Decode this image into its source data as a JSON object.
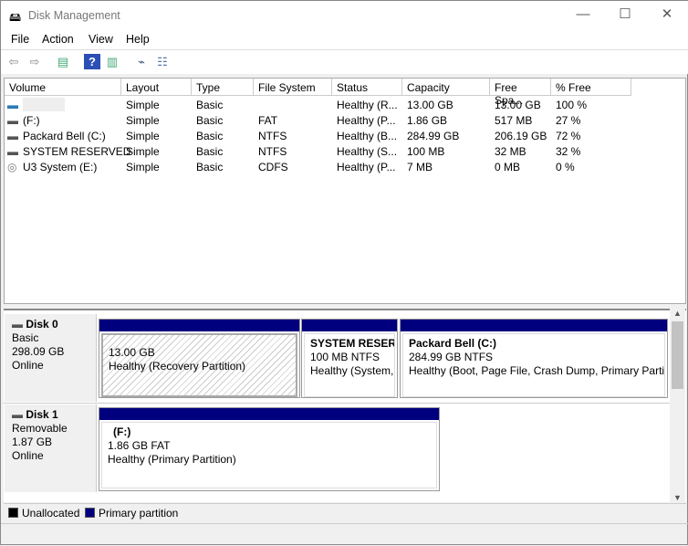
{
  "window": {
    "title": "Disk Management",
    "minimize": "—",
    "maximize": "☐",
    "close": "✕"
  },
  "menu": [
    "File",
    "Action",
    "View",
    "Help"
  ],
  "columns": [
    "Volume",
    "Layout",
    "Type",
    "File System",
    "Status",
    "Capacity",
    "Free Spa...",
    "% Free"
  ],
  "volumes": [
    {
      "volume": "",
      "layout": "Simple",
      "type": "Basic",
      "fs": "",
      "status": "Healthy (R...",
      "capacity": "13.00 GB",
      "free": "13.00 GB",
      "pct": "100 %"
    },
    {
      "volume": " (F:)",
      "layout": "Simple",
      "type": "Basic",
      "fs": "FAT",
      "status": "Healthy (P...",
      "capacity": "1.86 GB",
      "free": "517 MB",
      "pct": "27 %"
    },
    {
      "volume": "Packard Bell (C:)",
      "layout": "Simple",
      "type": "Basic",
      "fs": "NTFS",
      "status": "Healthy (B...",
      "capacity": "284.99 GB",
      "free": "206.19 GB",
      "pct": "72 %"
    },
    {
      "volume": "SYSTEM RESERVED",
      "layout": "Simple",
      "type": "Basic",
      "fs": "NTFS",
      "status": "Healthy (S...",
      "capacity": "100 MB",
      "free": "32 MB",
      "pct": "32 %"
    },
    {
      "volume": "U3 System (E:)",
      "layout": "Simple",
      "type": "Basic",
      "fs": "CDFS",
      "status": "Healthy (P...",
      "capacity": "7 MB",
      "free": "0 MB",
      "pct": "0 %"
    }
  ],
  "disks": [
    {
      "name": "Disk 0",
      "kind": "Basic",
      "size": "298.09 GB",
      "state": "Online",
      "partitions": [
        {
          "title": "",
          "size": "13.00 GB",
          "status": "Healthy (Recovery Partition)"
        },
        {
          "title": "SYSTEM RESERV",
          "size": "100 MB NTFS",
          "status": "Healthy (System,"
        },
        {
          "title": "Packard Bell  (C:)",
          "size": "284.99 GB NTFS",
          "status": "Healthy (Boot, Page File, Crash Dump, Primary Partiti"
        }
      ]
    },
    {
      "name": "Disk 1",
      "kind": "Removable",
      "size": "1.87 GB",
      "state": "Online",
      "partitions": [
        {
          "title": "(F:)",
          "size": "1.86 GB FAT",
          "status": "Healthy (Primary Partition)"
        }
      ]
    }
  ],
  "legend": [
    {
      "label": "Unallocated",
      "color": "#000000"
    },
    {
      "label": "Primary partition",
      "color": "#00007f"
    }
  ]
}
